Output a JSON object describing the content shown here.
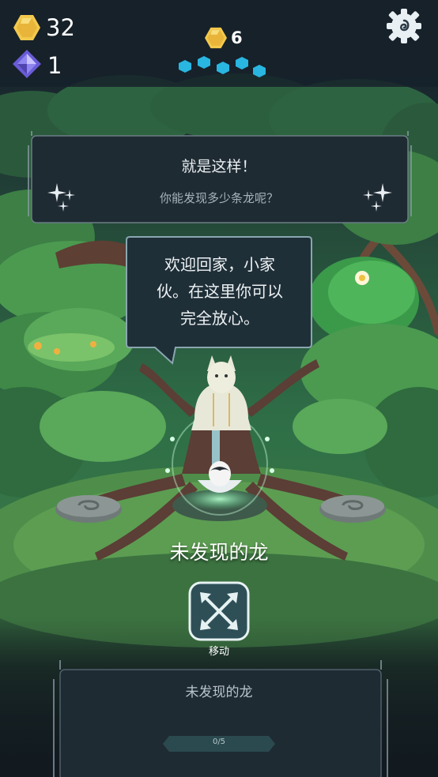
{
  "hud": {
    "coins": "32",
    "gems": "1",
    "center_coins": "6",
    "coin_icon": "gold-coin-icon",
    "gem_icon": "purple-gem-icon",
    "settings_icon": "gear-icon"
  },
  "banner": {
    "title": "就是这样！",
    "subtitle": "你能发现多少条龙呢？"
  },
  "speech": {
    "lines": [
      "欢迎回家，小家",
      "伙。在这里你可以",
      "完全放心。"
    ]
  },
  "dragon_label": "未发现的龙",
  "move_button": {
    "label": "移动",
    "icon": "move-arrows-icon"
  },
  "panel": {
    "title": "未发现的龙",
    "progress": "0/5",
    "progress_fraction": 0
  },
  "colors": {
    "gold": "#f2c94c",
    "teal": "#29b6e0",
    "panel_bg": "#1f2b33",
    "forest": "#3f8a4a",
    "button_bg": "#2f4f57"
  }
}
